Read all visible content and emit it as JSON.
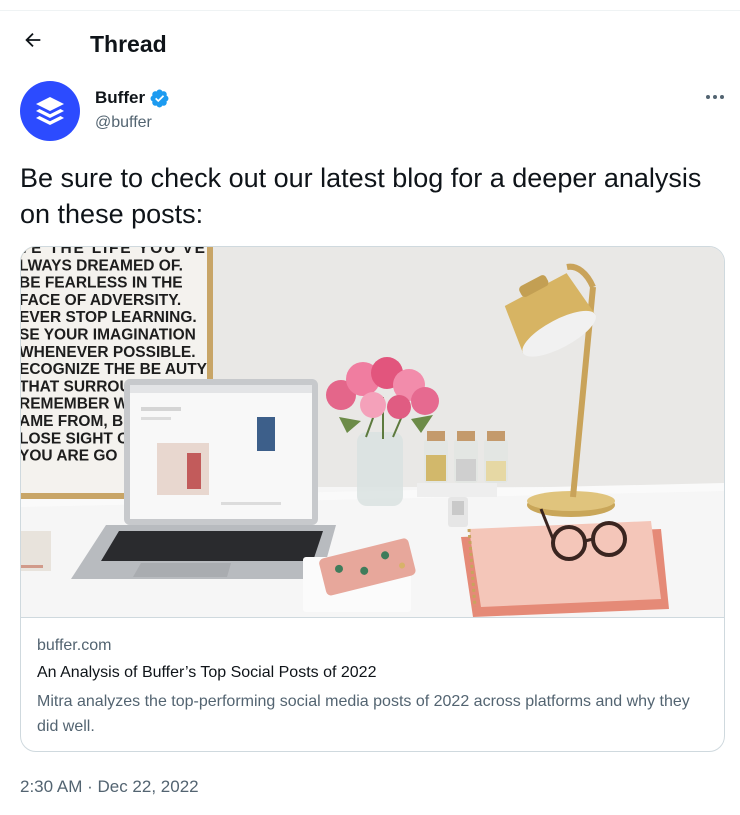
{
  "header": {
    "back_icon": "arrow-left-icon",
    "title": "Thread"
  },
  "tweet": {
    "author": {
      "name": "Buffer",
      "handle": "@buffer",
      "verified": true,
      "avatar_icon": "buffer-logo-icon",
      "avatar_color": "#2c4bff",
      "verified_color": "#1d9bf0"
    },
    "more_icon": "more-horizontal-icon",
    "text": "Be sure to check out our latest blog for a deeper analysis on these posts:",
    "card": {
      "image": {
        "poster_lines": [
          "VE THE LIFE YOU'VE",
          "LWAYS DREAMED OF.",
          "BE FEARLESS IN THE",
          "FACE OF ADVERSITY.",
          "EVER STOP LEARNING.",
          "SE YOUR IMAGINATION",
          "WHENEVER POSSIBLE.",
          "ECOGNIZE THE BE AUTY",
          "THAT SURROUN",
          "REMEMBER WHI",
          "AME FROM, BU",
          "LOSE SIGHT OF",
          "YOU ARE GO"
        ]
      },
      "domain": "buffer.com",
      "title": "An Analysis of Buffer’s Top Social Posts of 2022",
      "description": "Mitra analyzes the top-performing social media posts of 2022 across platforms and why they did well."
    },
    "timestamp": "2:30 AM · Dec 22, 2022"
  },
  "colors": {
    "text_primary": "#0f1419",
    "text_secondary": "#536471",
    "border": "#cfd9de"
  }
}
